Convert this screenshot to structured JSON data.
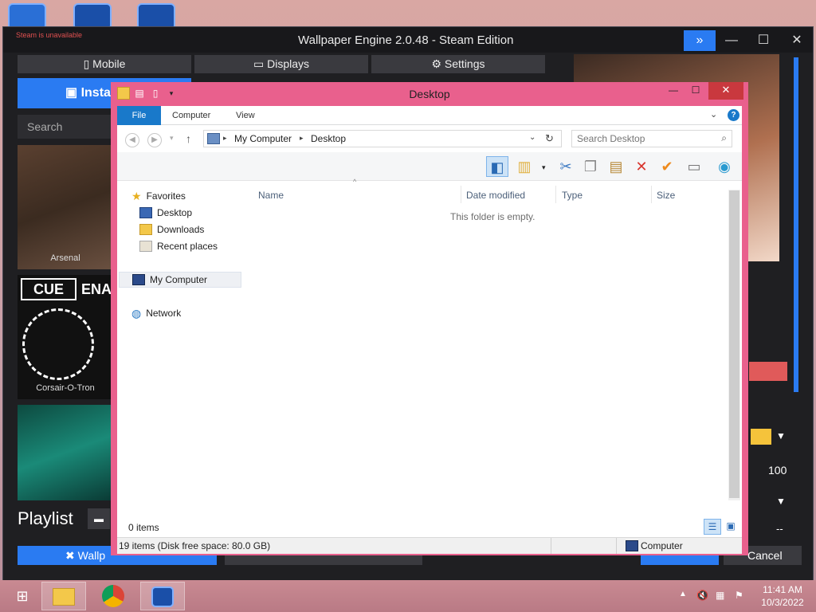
{
  "background_app": {
    "title": "Wallpaper Engine 2.0.48 - Steam Edition",
    "steam_status": "Steam is unavailable",
    "tabs": [
      "Mobile",
      "Displays",
      "Settings"
    ],
    "installed_tab": "Insta",
    "search_placeholder": "Search",
    "thumbnails": [
      "Arsenal",
      "Corsair-O-Tron"
    ],
    "cue_label": "CUE",
    "enable_label": "ENAB",
    "playlist_label": "Playlist",
    "bottom_left": "Wallp",
    "bottom_right": "Cancel",
    "value_100": "100",
    "dashes": "--",
    "colors": {
      "accent": "#2a7bf2",
      "red_bar": "#e05a5a",
      "yellow": "#f5c33b"
    }
  },
  "explorer": {
    "title": "Desktop",
    "ribbon_tabs": [
      "File",
      "Computer",
      "View"
    ],
    "breadcrumb": [
      "My Computer",
      "Desktop"
    ],
    "search_placeholder": "Search Desktop",
    "columns": [
      "Name",
      "Date modified",
      "Type",
      "Size"
    ],
    "empty_message": "This folder is empty.",
    "nav": {
      "favorites": "Favorites",
      "favorites_items": [
        "Desktop",
        "Downloads",
        "Recent places"
      ],
      "my_computer": "My Computer",
      "network": "Network"
    },
    "item_count": "0 items",
    "status_left": "19 items (Disk free space: 80.0 GB)",
    "status_right": "Computer",
    "colors": {
      "frame": "#e9608d",
      "file_tab": "#1979ca",
      "close": "#c9383e"
    }
  },
  "taskbar": {
    "time": "11:41 AM",
    "date": "10/3/2022"
  }
}
